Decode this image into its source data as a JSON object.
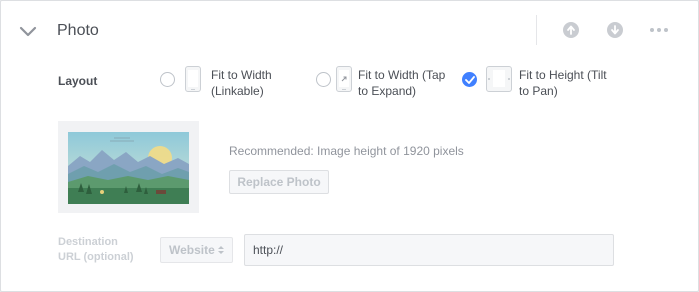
{
  "section": {
    "title": "Photo"
  },
  "header_actions": {
    "collapse_icon": "chevron-down-icon",
    "move_up_icon": "arrow-up-icon",
    "move_down_icon": "arrow-down-icon",
    "more_icon": "ellipsis-icon"
  },
  "layout": {
    "label": "Layout",
    "options": [
      {
        "line1": "Fit to Width",
        "line2": "(Linkable)",
        "selected": false
      },
      {
        "line1": "Fit to Width (Tap",
        "line2": "to Expand)",
        "selected": false
      },
      {
        "line1": "Fit to Height (Tilt",
        "line2": "to Pan)",
        "selected": true
      }
    ]
  },
  "photo": {
    "recommendation": "Recommended: Image height of 1920 pixels",
    "replace_label": "Replace Photo"
  },
  "destination": {
    "label_line1": "Destination",
    "label_line2": "URL (optional)",
    "type_value": "Website",
    "url_value": "http://"
  },
  "colors": {
    "accent": "#4080ff",
    "text": "#4b4f56",
    "muted": "#90949c",
    "disabled": "#bec3c9"
  }
}
